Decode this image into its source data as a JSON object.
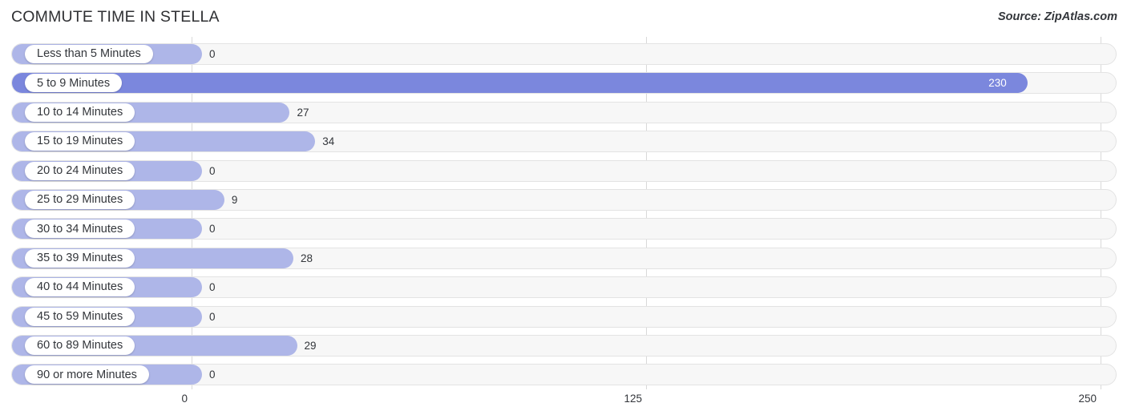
{
  "header": {
    "title": "COMMUTE TIME IN STELLA",
    "source": "Source: ZipAtlas.com"
  },
  "colors": {
    "bar": "#aeb6e8",
    "bar_highlight": "#7b87dd",
    "track": "#f7f7f7",
    "track_border": "#e3e3e3",
    "gridline": "#d9d9d9",
    "text": "#33363b",
    "value_inside": "#ffffff"
  },
  "chart_data": {
    "type": "bar",
    "orientation": "horizontal",
    "title": "COMMUTE TIME IN STELLA",
    "xlabel": "",
    "ylabel": "",
    "xlim": [
      0,
      250
    ],
    "xticks": [
      0,
      125,
      250
    ],
    "xtick_labels": [
      "0",
      "125",
      "250"
    ],
    "grid": true,
    "legend": false,
    "highlight_category": "5 to 9 Minutes",
    "categories": [
      "Less than 5 Minutes",
      "5 to 9 Minutes",
      "10 to 14 Minutes",
      "15 to 19 Minutes",
      "20 to 24 Minutes",
      "25 to 29 Minutes",
      "30 to 34 Minutes",
      "35 to 39 Minutes",
      "40 to 44 Minutes",
      "45 to 59 Minutes",
      "60 to 89 Minutes",
      "90 or more Minutes"
    ],
    "values": [
      0,
      230,
      27,
      34,
      0,
      9,
      0,
      28,
      0,
      0,
      29,
      0
    ],
    "value_labels": [
      "0",
      "230",
      "27",
      "34",
      "0",
      "9",
      "0",
      "28",
      "0",
      "0",
      "29",
      "0"
    ]
  },
  "rows": [
    {
      "label": "Less than 5 Minutes",
      "value": 0,
      "value_label": "0",
      "highlight": false,
      "value_inside": false
    },
    {
      "label": "5 to 9 Minutes",
      "value": 230,
      "value_label": "230",
      "highlight": true,
      "value_inside": true
    },
    {
      "label": "10 to 14 Minutes",
      "value": 27,
      "value_label": "27",
      "highlight": false,
      "value_inside": false
    },
    {
      "label": "15 to 19 Minutes",
      "value": 34,
      "value_label": "34",
      "highlight": false,
      "value_inside": false
    },
    {
      "label": "20 to 24 Minutes",
      "value": 0,
      "value_label": "0",
      "highlight": false,
      "value_inside": false
    },
    {
      "label": "25 to 29 Minutes",
      "value": 9,
      "value_label": "9",
      "highlight": false,
      "value_inside": false
    },
    {
      "label": "30 to 34 Minutes",
      "value": 0,
      "value_label": "0",
      "highlight": false,
      "value_inside": false
    },
    {
      "label": "35 to 39 Minutes",
      "value": 28,
      "value_label": "28",
      "highlight": false,
      "value_inside": false
    },
    {
      "label": "40 to 44 Minutes",
      "value": 0,
      "value_label": "0",
      "highlight": false,
      "value_inside": false
    },
    {
      "label": "45 to 59 Minutes",
      "value": 0,
      "value_label": "0",
      "highlight": false,
      "value_inside": false
    },
    {
      "label": "60 to 89 Minutes",
      "value": 29,
      "value_label": "29",
      "highlight": false,
      "value_inside": false
    },
    {
      "label": "90 or more Minutes",
      "value": 0,
      "value_label": "0",
      "highlight": false,
      "value_inside": false
    }
  ],
  "axis": {
    "ticks": [
      "0",
      "125",
      "250"
    ]
  }
}
